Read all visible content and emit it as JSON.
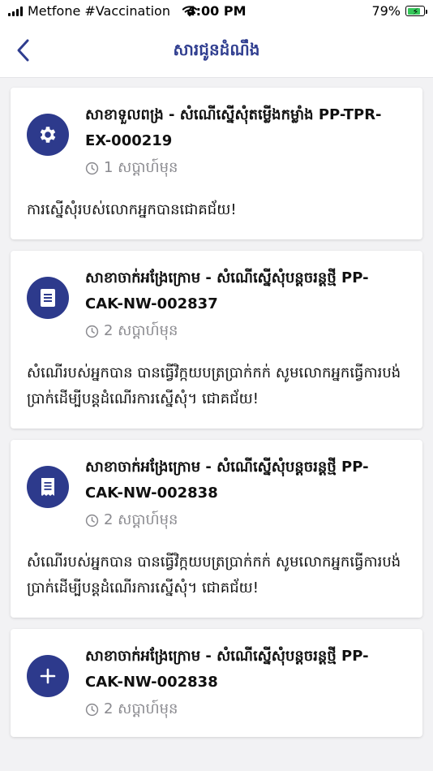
{
  "status_bar": {
    "carrier": "Metfone #Vaccination",
    "time": "4:00 PM",
    "battery": "79%"
  },
  "nav": {
    "title": "សារជូនដំណឹង",
    "back_icon": "chevron-left-icon"
  },
  "colors": {
    "accent": "#2d3a8c",
    "title_blue": "#2f3d8f",
    "muted": "#8a8a8f",
    "background": "#f2f2f4"
  },
  "notifications": [
    {
      "icon": "gear-icon",
      "title": "សាខាទួលពង្រ - សំណើស្នើសុំតម្លើងកម្លាំង PP-TPR-EX-000219",
      "time": "1 សប្តាហ៍មុន",
      "body": "ការស្នើសុំរបស់លោកអ្នកបានជោគជ័យ!"
    },
    {
      "icon": "document-icon",
      "title": "សាខាចាក់អង្រែក្រោម - សំណើស្នើសុំបន្តចរន្តថ្មី PP-CAK-NW-002837",
      "time": "2 សប្តាហ៍មុន",
      "body": "សំណើរបស់អ្នកបាន បានធ្វើវិក្កយបត្រប្រាក់កក់ សូមលោកអ្នកធ្វើការបង់ប្រាក់ដើម្បីបន្តដំណើរការស្នើសុំ។ ជោគជ័យ!"
    },
    {
      "icon": "receipt-icon",
      "title": "សាខាចាក់អង្រែក្រោម - សំណើស្នើសុំបន្តចរន្តថ្មី PP-CAK-NW-002838",
      "time": "2 សប្តាហ៍មុន",
      "body": "សំណើរបស់អ្នកបាន បានធ្វើវិក្កយបត្រប្រាក់កក់ សូមលោកអ្នកធ្វើការបង់ប្រាក់ដើម្បីបន្តដំណើរការស្នើសុំ។ ជោគជ័យ!"
    },
    {
      "icon": "plus-icon",
      "title": "សាខាចាក់អង្រែក្រោម - សំណើស្នើសុំបន្តចរន្តថ្មី PP-CAK-NW-002838",
      "time": "2 សប្តាហ៍មុន",
      "body": ""
    }
  ]
}
